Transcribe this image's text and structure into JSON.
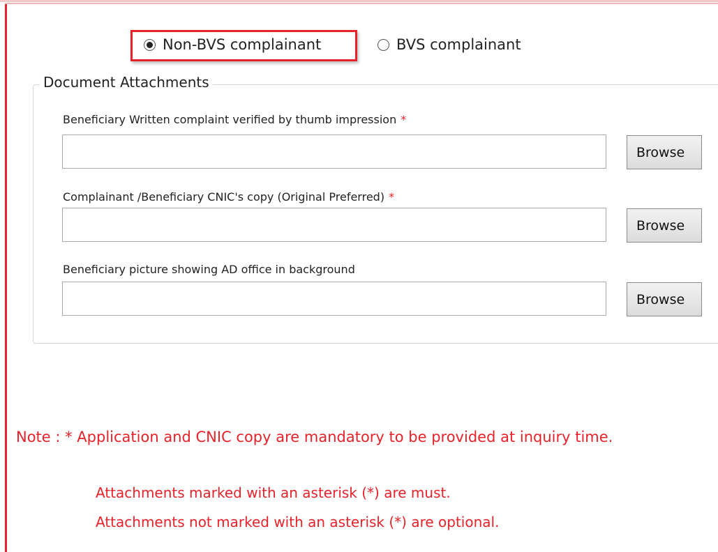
{
  "complainant_type": {
    "options": [
      {
        "label": "Non-BVS complainant",
        "selected": true
      },
      {
        "label": "BVS complainant",
        "selected": false
      }
    ]
  },
  "attachments": {
    "legend": "Document Attachments",
    "fields": [
      {
        "label": "Beneficiary Written complaint verified by thumb impression",
        "required_mark": "*",
        "value": "",
        "button": "Browse"
      },
      {
        "label": "Complainant /Beneficiary CNIC's copy (Original Preferred)",
        "required_mark": "*",
        "value": "",
        "button": "Browse"
      },
      {
        "label": "Beneficiary picture showing AD office in background",
        "required_mark": "",
        "value": "",
        "button": "Browse"
      }
    ]
  },
  "notes": {
    "main": "Note : * Application and CNIC copy are mandatory to be provided at inquiry time.",
    "lines": [
      "Attachments marked with an asterisk (*) are must.",
      "Attachments not marked with an asterisk (*) are optional."
    ]
  },
  "colors": {
    "accent_red": "#e8222a",
    "border_gray": "#d6d6d6"
  }
}
